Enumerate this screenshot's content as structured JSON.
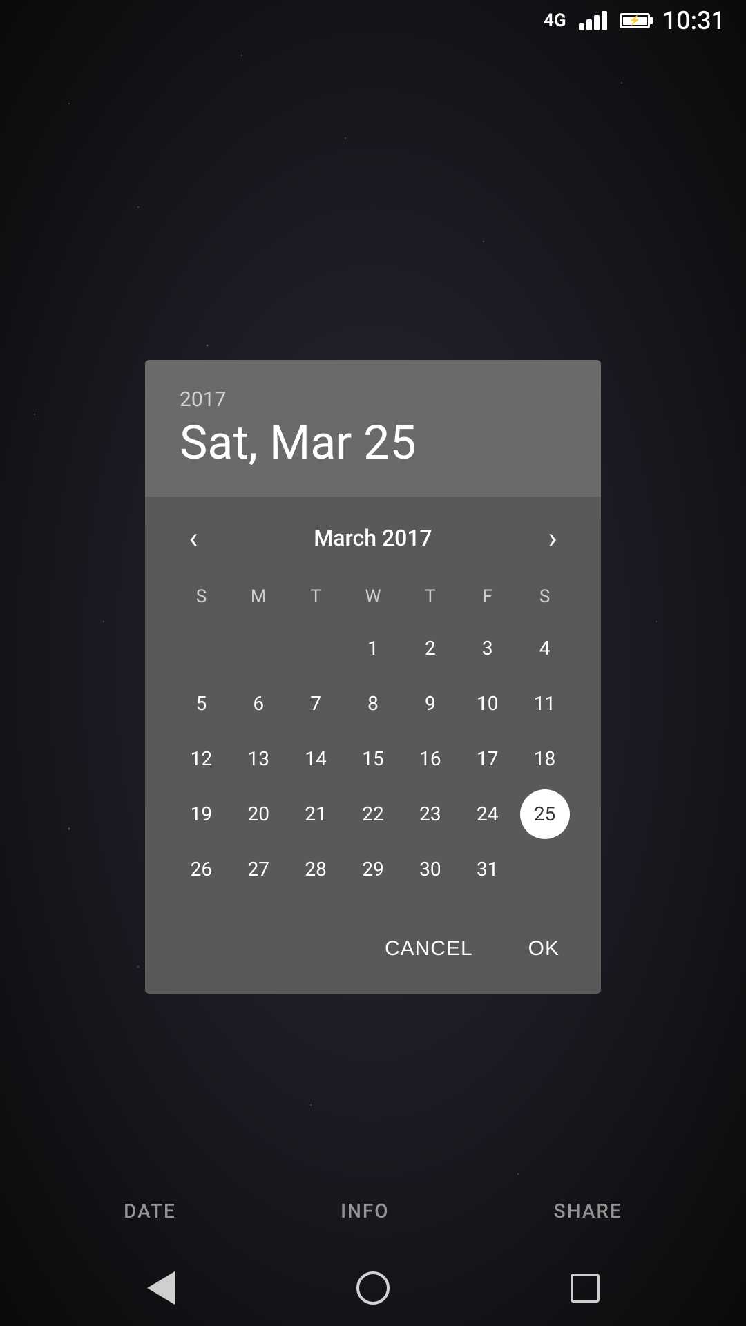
{
  "statusBar": {
    "network": "4G",
    "time": "10:31"
  },
  "dialog": {
    "year": "2017",
    "selectedDateLabel": "Sat, Mar 25",
    "monthYearLabel": "March 2017",
    "selectedDay": 25,
    "prevArrow": "‹",
    "nextArrow": "›",
    "dayHeaders": [
      "S",
      "M",
      "T",
      "W",
      "T",
      "F",
      "S"
    ],
    "weeks": [
      [
        "",
        "",
        "",
        "1",
        "2",
        "3",
        "4"
      ],
      [
        "5",
        "6",
        "7",
        "8",
        "9",
        "10",
        "11"
      ],
      [
        "12",
        "13",
        "14",
        "15",
        "16",
        "17",
        "18"
      ],
      [
        "19",
        "20",
        "21",
        "22",
        "23",
        "24",
        "25"
      ],
      [
        "26",
        "27",
        "28",
        "29",
        "30",
        "31",
        ""
      ]
    ],
    "cancelLabel": "CANCEL",
    "okLabel": "OK"
  },
  "bottomTabs": {
    "date": "DATE",
    "info": "INFO",
    "share": "SHARE"
  }
}
